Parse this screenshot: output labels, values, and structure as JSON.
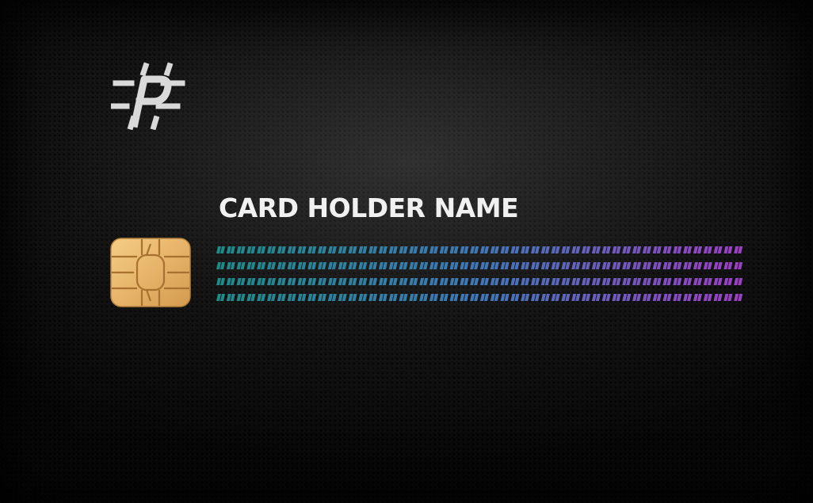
{
  "card": {
    "holder_name": "CARD HOLDER NAME",
    "logo_icon": "hash-p-logo-icon",
    "chip_icon": "emv-chip-icon",
    "pattern": {
      "rows": 4,
      "columns": 52,
      "color_start": "#1e8a8a",
      "color_mid": "#3f78b8",
      "color_end": "#9b3fc4"
    },
    "colors": {
      "background": "#141414",
      "text": "#f1f1f1",
      "logo": "#d8d8d8",
      "chip": "#e8b96d"
    }
  }
}
